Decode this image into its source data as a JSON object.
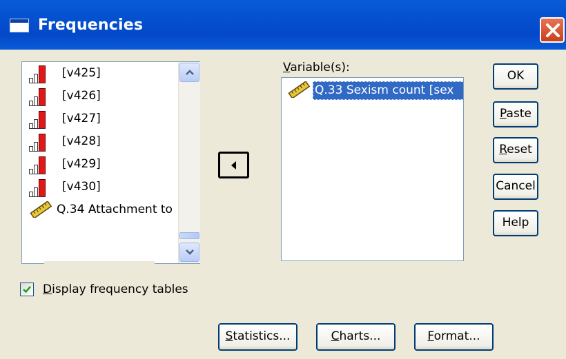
{
  "window": {
    "title": "Frequencies"
  },
  "source_list": {
    "items": [
      {
        "label": "[v425]",
        "icon": "ordinal-bars-icon"
      },
      {
        "label": "[v426]",
        "icon": "ordinal-bars-icon"
      },
      {
        "label": "[v427]",
        "icon": "ordinal-bars-icon"
      },
      {
        "label": "[v428]",
        "icon": "ordinal-bars-icon"
      },
      {
        "label": "[v429]",
        "icon": "ordinal-bars-icon"
      },
      {
        "label": "[v430]",
        "icon": "ordinal-bars-icon"
      },
      {
        "label": "Q.34 Attachment to",
        "icon": "scale-ruler-icon"
      }
    ]
  },
  "target": {
    "label_first": "V",
    "label_rest": "ariable(s):",
    "items": [
      {
        "label": "Q.33 Sexism count [sex",
        "icon": "scale-ruler-icon",
        "selected": true
      }
    ]
  },
  "buttons": {
    "ok": "OK",
    "paste_u": "P",
    "paste_rest": "aste",
    "reset_u": "R",
    "reset_rest": "eset",
    "cancel": "Cancel",
    "help": "Help",
    "statistics_u": "S",
    "statistics_rest": "tatistics...",
    "charts_u": "C",
    "charts_rest": "harts...",
    "format_u": "F",
    "format_rest": "ormat..."
  },
  "checkbox": {
    "checked": true,
    "label_u": "D",
    "label_rest": "isplay frequency tables"
  },
  "colors": {
    "titlebar": "#0451d0",
    "selection": "#316ac5",
    "dialog_bg": "#ece9d8",
    "close": "#c8411a",
    "ordinal_bar_red": "#e01818",
    "ruler_yellow": "#e8c83a"
  }
}
